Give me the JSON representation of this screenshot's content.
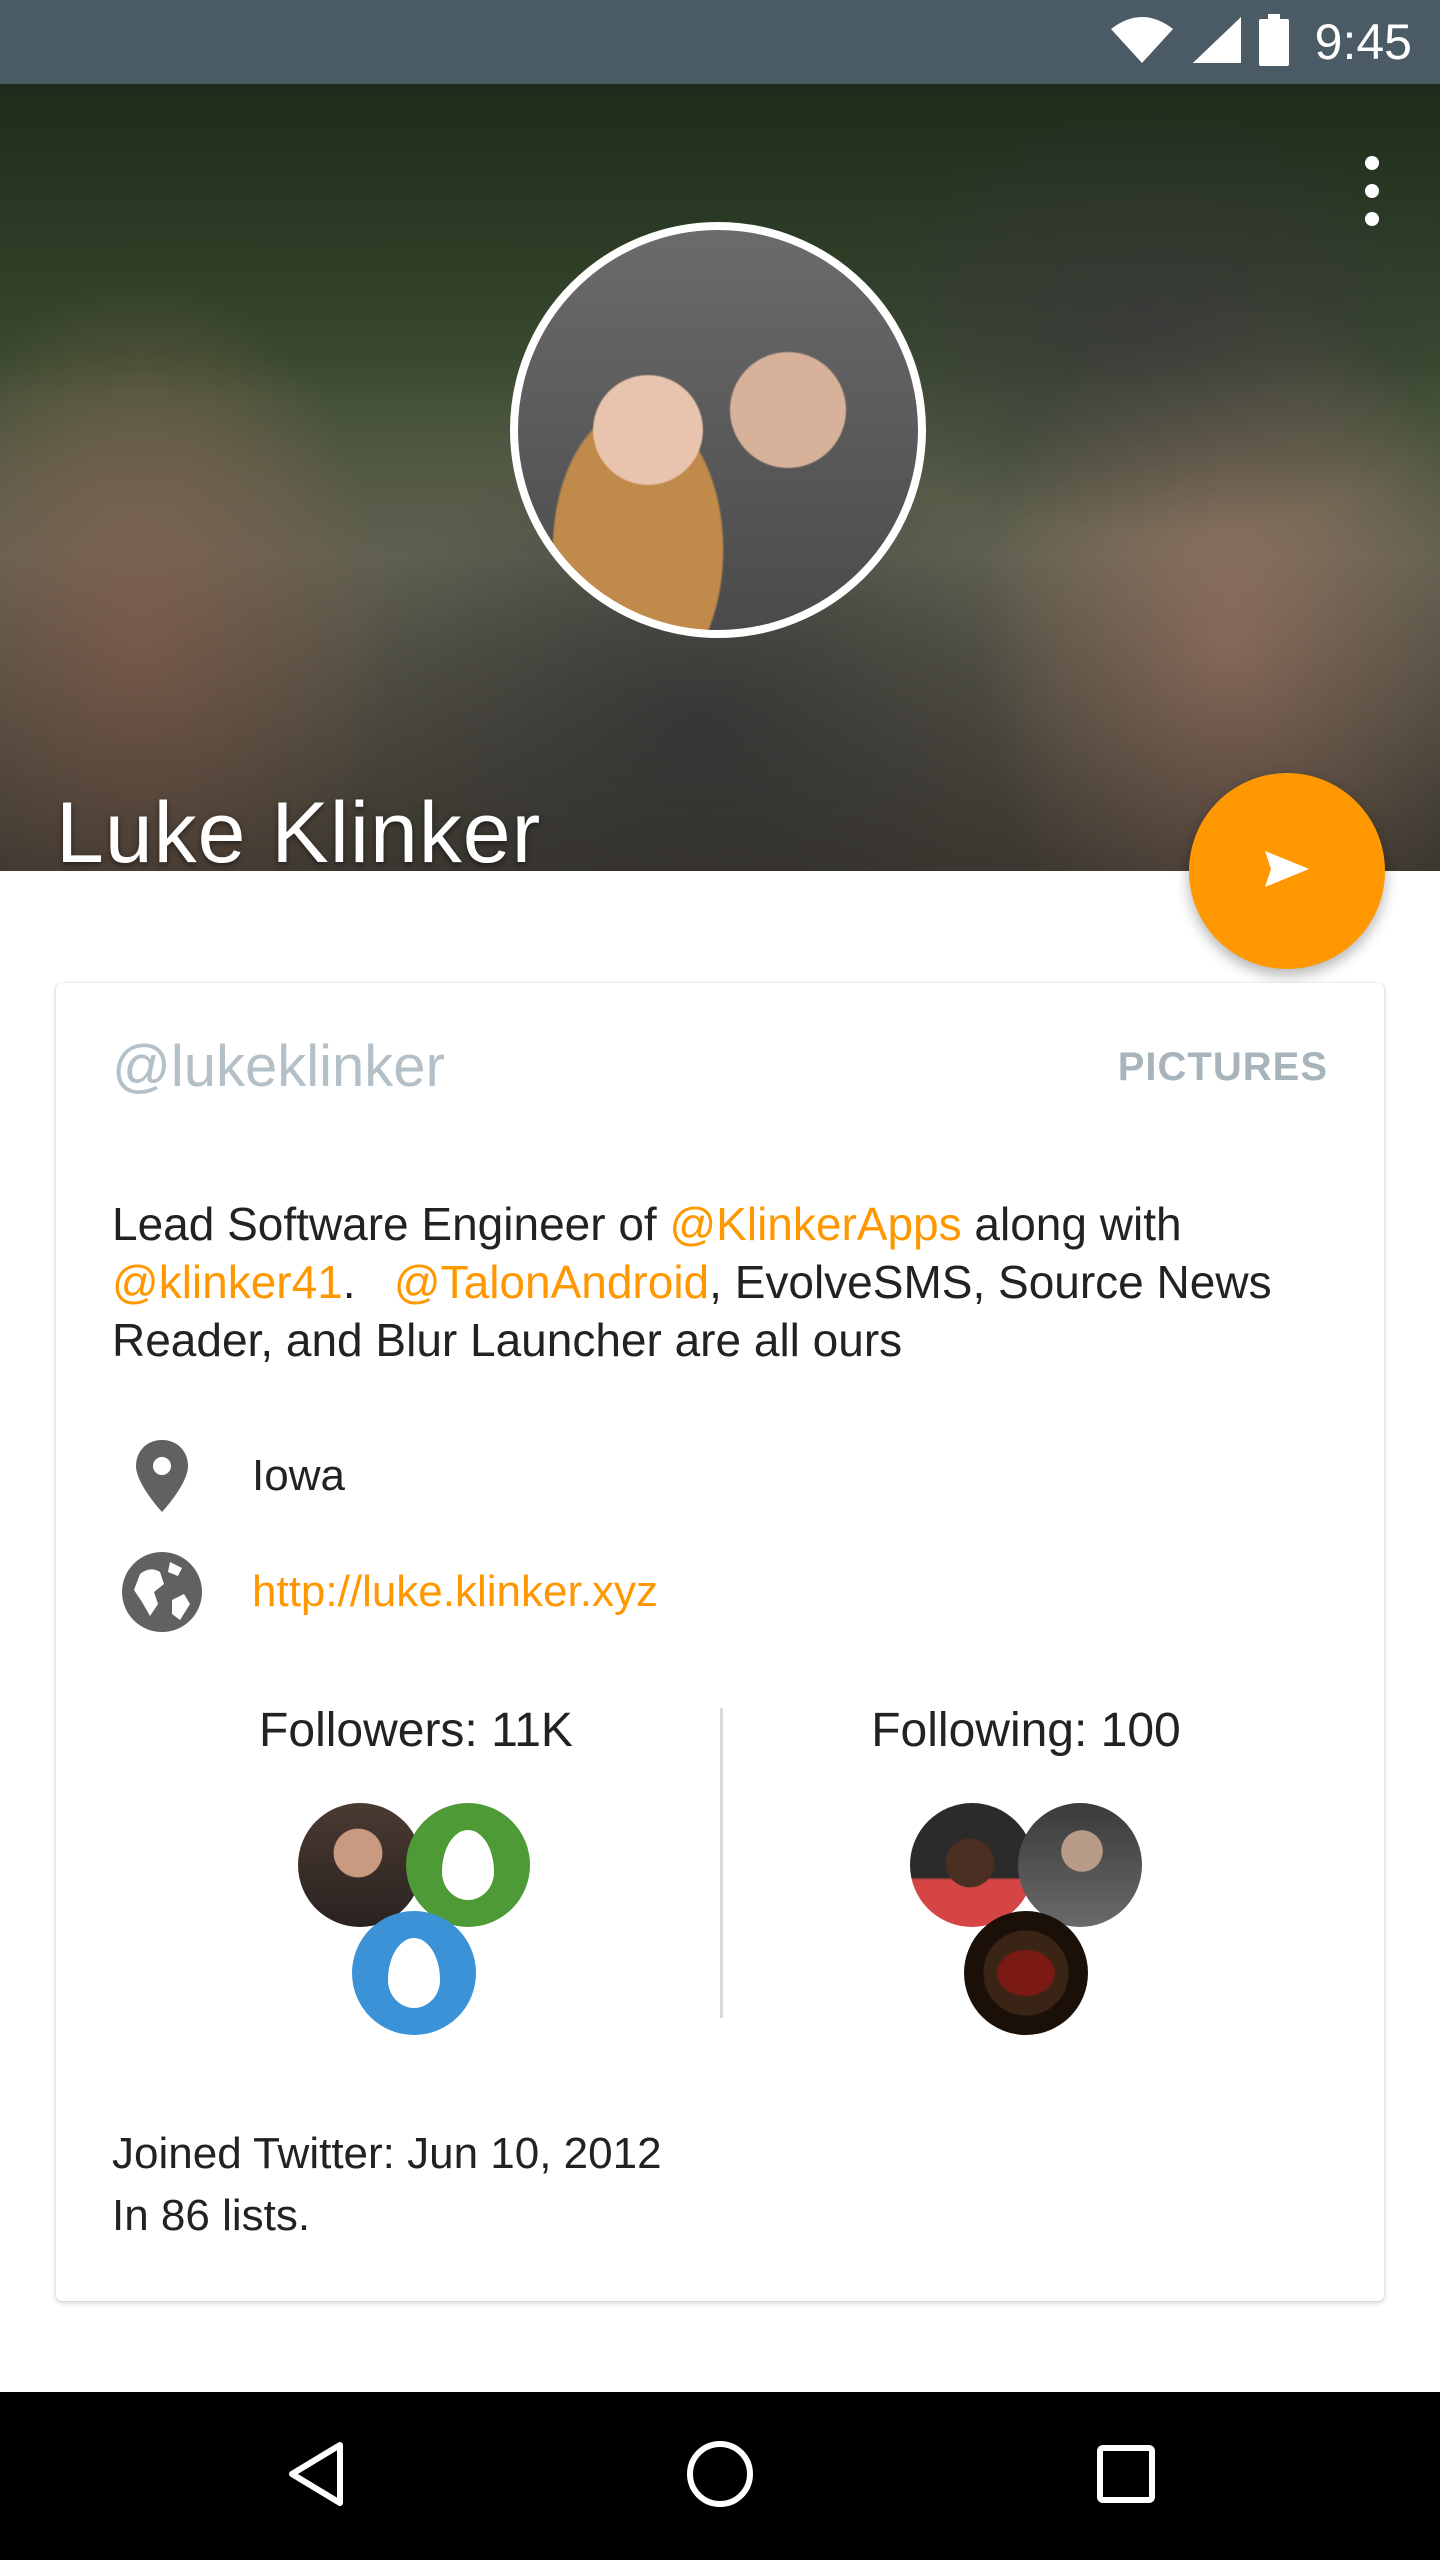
{
  "status_bar": {
    "time": "9:45",
    "icons": [
      "wifi-icon",
      "signal-icon",
      "battery-icon"
    ]
  },
  "profile": {
    "name": "Luke Klinker",
    "handle": "@lukeklinker",
    "pictures_label": "PICTURES",
    "bio": {
      "part1": "Lead Software Engineer of ",
      "mention1": "@KlinkerApps",
      "part2": " along with ",
      "mention2": "@klinker41",
      "part3": ".   ",
      "mention3": "@TalonAndroid",
      "part4": ", EvolveSMS, Source News Reader, and Blur Launcher are all ours"
    },
    "location": "Iowa",
    "website": "http://luke.klinker.xyz",
    "followers_label": "Followers: 11K",
    "following_label": "Following: 100",
    "joined": "Joined Twitter: Jun 10, 2012",
    "lists": "In 86 lists."
  },
  "colors": {
    "accent": "#ff9800",
    "status_bar": "#4a5b66",
    "handle": "#b3c0c8"
  }
}
